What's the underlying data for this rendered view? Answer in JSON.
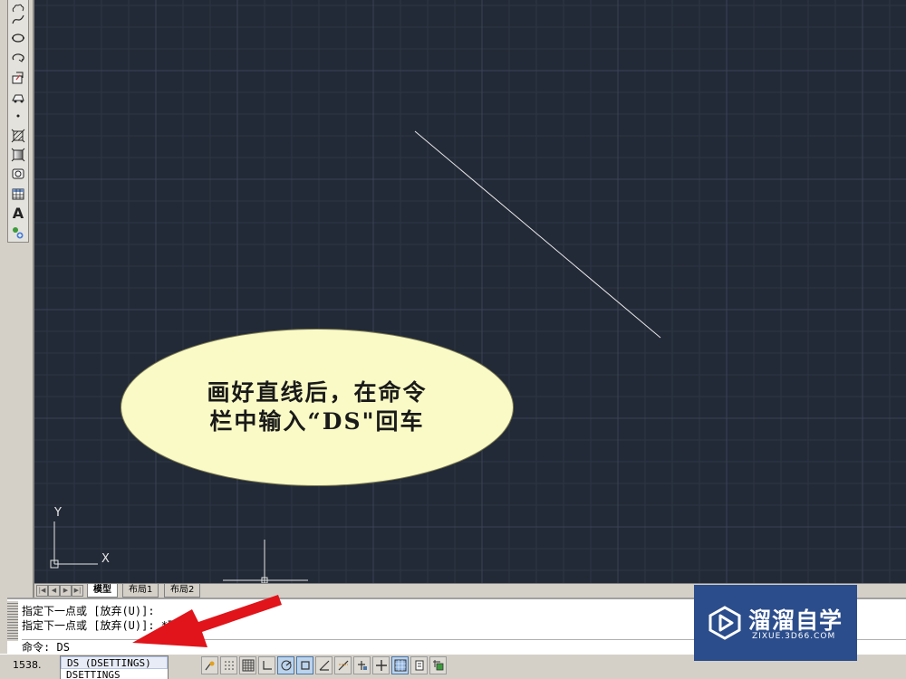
{
  "canvas": {
    "background_color": "#232a37",
    "ucs_axes": {
      "y_label": "Y",
      "x_label": "X"
    }
  },
  "left_toolbar": {
    "tools": [
      "revision-cloud-icon",
      "spline-icon",
      "ellipse-icon",
      "ellipse-arc-icon",
      "insert-block-icon",
      "make-block-icon",
      "point-icon",
      "hatch-icon",
      "gradient-icon",
      "region-icon",
      "table-icon",
      "multiline-text-icon",
      "add-selected-icon"
    ],
    "text_tool_glyph": "A"
  },
  "layout_tabs": [
    {
      "label": "模型",
      "active": true
    },
    {
      "label": "布局1",
      "active": false
    },
    {
      "label": "布局2",
      "active": false
    }
  ],
  "command_window": {
    "history": [
      "指定下一点或 [放弃(U)]:",
      "指定下一点或 [放弃(U)]: *取消*"
    ],
    "prompt_label": "命令:",
    "prompt_value": "DS"
  },
  "autocomplete": {
    "options": [
      "DS (DSETTINGS)",
      "DSETTINGS"
    ],
    "selected_index": 0
  },
  "status_bar": {
    "coordinates": "1538.",
    "buttons": [
      {
        "icon": "infer-constraints-icon",
        "on": false
      },
      {
        "icon": "snap-mode-icon",
        "on": false
      },
      {
        "icon": "grid-display-icon",
        "on": false
      },
      {
        "icon": "ortho-mode-icon",
        "on": false
      },
      {
        "icon": "polar-tracking-icon",
        "on": true
      },
      {
        "icon": "object-snap-icon",
        "on": true
      },
      {
        "icon": "3d-object-snap-icon",
        "on": false
      },
      {
        "icon": "object-snap-tracking-icon",
        "on": false
      },
      {
        "icon": "dynamic-ucs-icon",
        "on": false
      },
      {
        "icon": "dynamic-input-icon",
        "on": true
      },
      {
        "icon": "lineweight-icon",
        "on": false
      },
      {
        "icon": "transparency-icon",
        "on": true
      },
      {
        "icon": "quick-properties-icon",
        "on": false
      },
      {
        "icon": "selection-cycling-icon",
        "on": true
      }
    ]
  },
  "callout": {
    "line1": "画好直线后，在命令",
    "line2": "栏中输入“DS\"回车"
  },
  "annotation": {
    "arrow_color": "#e0141a"
  },
  "watermark": {
    "name": "溜溜自学",
    "url": "ZIXUE.3D66.COM"
  }
}
